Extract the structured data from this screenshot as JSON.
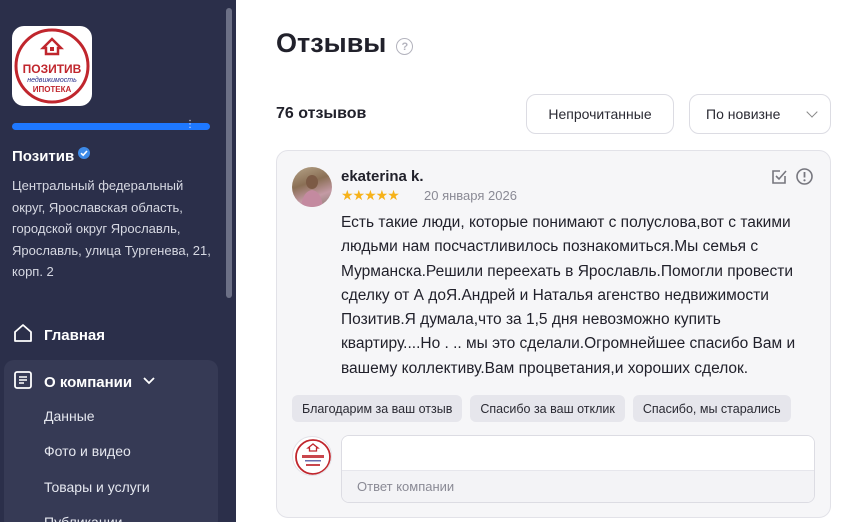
{
  "sidebar": {
    "logo": {
      "brand": "ПОЗИТИВ",
      "tagline": "недвижимость",
      "product": "ИПОТЕКА"
    },
    "company_name": "Позитив",
    "address": "Центральный федеральный округ, Ярославская область, городской округ Ярославль, Ярославль, улица Тургенева, 21, корп. 2",
    "nav": {
      "home": "Главная",
      "about": "О компании",
      "sub_items": [
        "Данные",
        "Фото и видео",
        "Товары и услуги",
        "Публикации"
      ]
    }
  },
  "main": {
    "title": "Отзывы",
    "reviews_count": "76 отзывов",
    "filter_button": "Непрочитанные",
    "sort_button": "По новизне"
  },
  "review": {
    "author": "ekaterina k.",
    "rating": 5,
    "stars": "★★★★★",
    "date": "20 января 2026",
    "text": "Есть такие люди, которые понимают с полуслова,вот с такими людьми нам посчастливилось познакомиться.Мы семья с Мурманска.Решили переехать в Ярославль.Помогли провести сделку от А доЯ.Андрей и Наталья агенство недвижимости Позитив.Я думала,что за 1,5 дня невозможно купить квартиру....Но . .. мы это сделали.Огромнейшее спасибо Вам и вашему коллективу.Вам процветания,и хороших сделок.",
    "quick_replies": [
      "Благодарим за ваш отзыв",
      "Спасибо за ваш отклик",
      "Спасибо, мы старались"
    ],
    "reply_value": "",
    "reply_label": "Ответ компании"
  },
  "colors": {
    "sidebar_bg": "#2b2f4a",
    "accent_blue": "#1e78ff",
    "star": "#f6b21a",
    "logo_red": "#c0262d"
  }
}
